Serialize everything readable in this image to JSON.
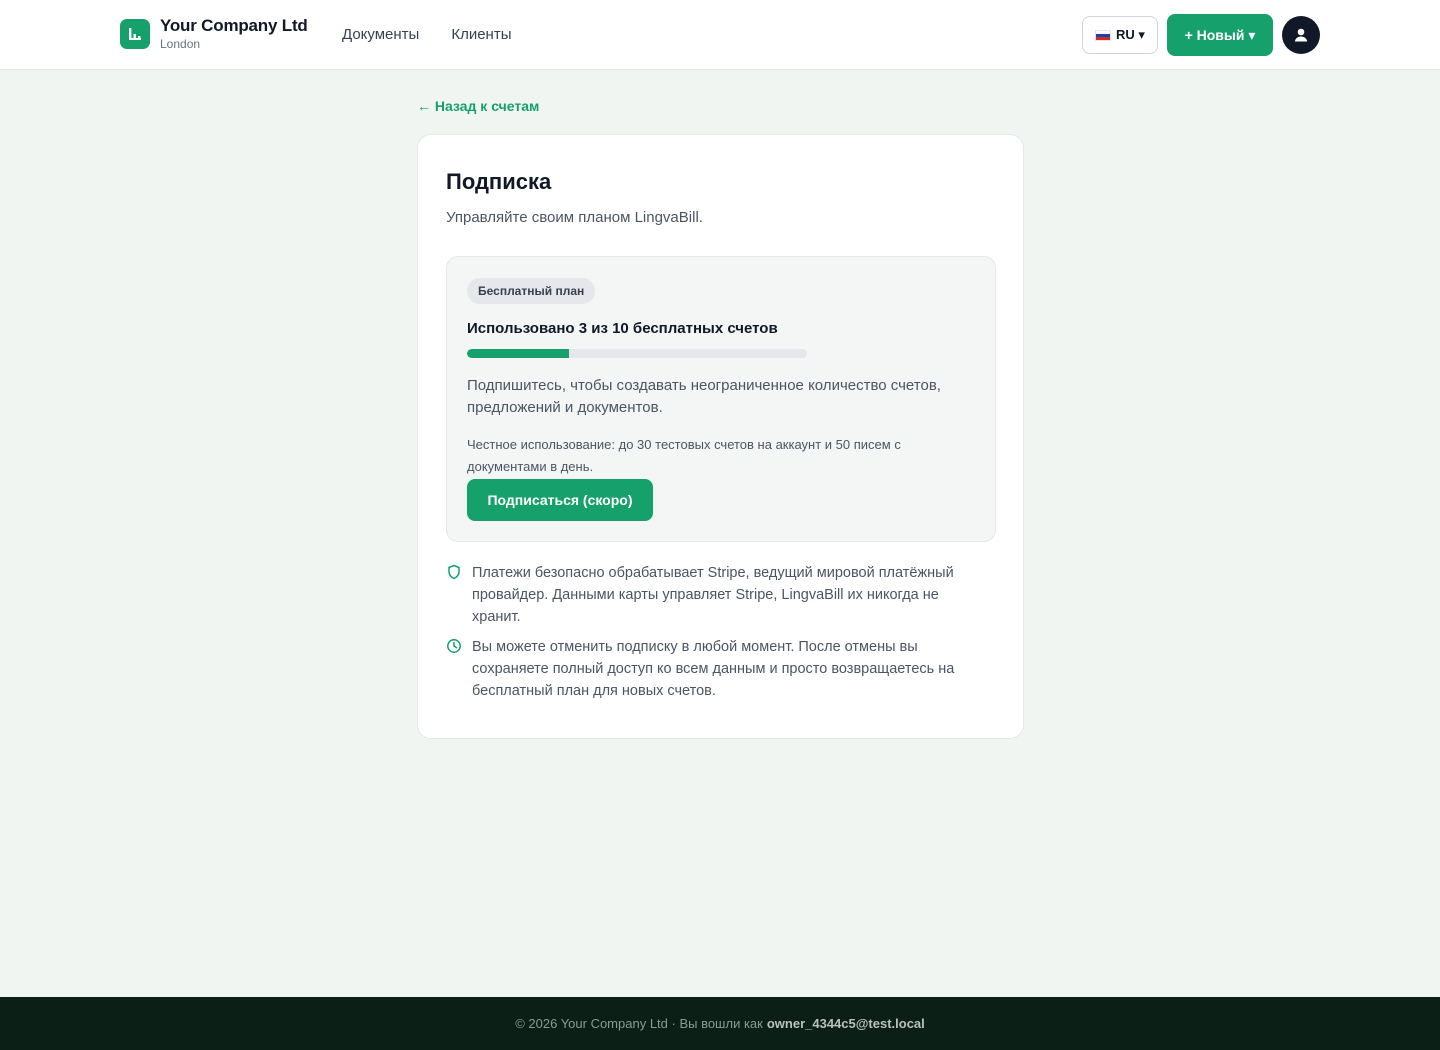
{
  "header": {
    "company_name": "Your Company Ltd",
    "company_city": "London",
    "nav": [
      "Документы",
      "Клиенты"
    ],
    "lang_label": "RU ▾",
    "new_label": "+ Новый ▾"
  },
  "back_link": "← Назад к счетам",
  "card": {
    "title": "Подписка",
    "subtitle": "Управляйте своим планом LingvaBill.",
    "plan": {
      "badge": "Бесплатный план",
      "usage_text": "Использовано 3 из 10 бесплатных счетов",
      "usage_used": 3,
      "usage_total": 10,
      "description": "Подпишитесь, чтобы создавать неограниченное количество счетов, предложений и документов.",
      "fair_use": "Честное использование: до 30 тестовых счетов на аккаунт и 50 писем с документами в день.",
      "subscribe_label": "Подписаться (скоро)"
    },
    "notes": [
      {
        "icon": "shield-icon",
        "text": "Платежи безопасно обрабатывает Stripe, ведущий мировой платёжный провайдер. Данными карты управляет Stripe, LingvaBill их никогда не хранит."
      },
      {
        "icon": "clock-icon",
        "text": "Вы можете отменить подписку в любой момент. После отмены вы сохраняете полный доступ ко всем данным и просто возвращаетесь на бесплатный план для новых счетов."
      }
    ]
  },
  "footer": {
    "text": "© 2026 Your Company Ltd · Вы вошли как",
    "user": "owner_4344c5@test.local"
  },
  "colors": {
    "accent": "#15a06c",
    "background": "#f1f5f2",
    "footer": "#0c1f17"
  }
}
